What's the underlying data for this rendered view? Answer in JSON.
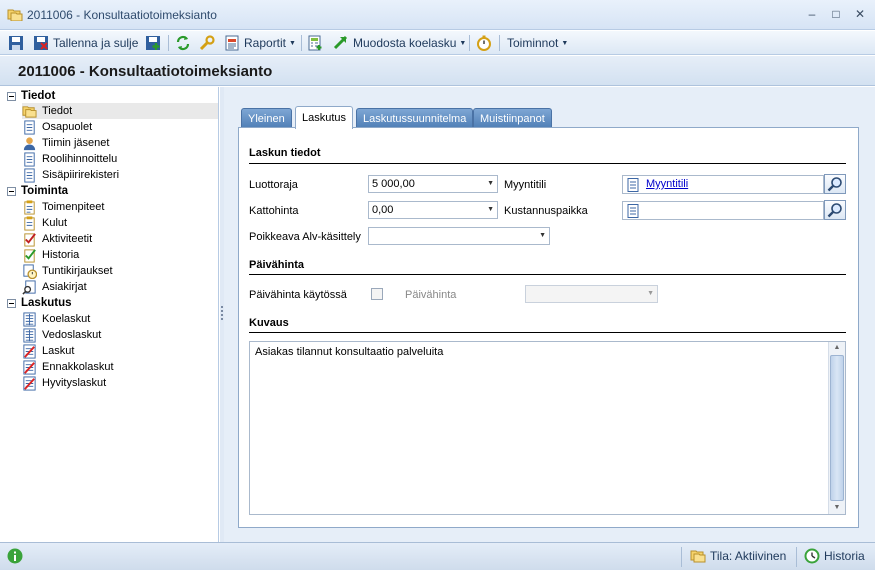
{
  "window": {
    "title": "2011006 - Konsultaatiotoimeksianto"
  },
  "toolbar": {
    "save_close_label": "Tallenna ja sulje",
    "reports_label": "Raportit",
    "invoice_label": "Muodosta koelasku",
    "actions_label": "Toiminnot"
  },
  "header": {
    "title": "2011006 - Konsultaatiotoimeksianto"
  },
  "sidebar": {
    "groups": [
      {
        "label": "Tiedot",
        "items": [
          "Tiedot",
          "Osapuolet",
          "Tiimin jäsenet",
          "Roolihinnoittelu",
          "Sisäpiirirekisteri"
        ]
      },
      {
        "label": "Toiminta",
        "items": [
          "Toimenpiteet",
          "Kulut",
          "Aktiviteetit",
          "Historia",
          "Tuntikirjaukset",
          "Asiakirjat"
        ]
      },
      {
        "label": "Laskutus",
        "items": [
          "Koelaskut",
          "Vedoslaskut",
          "Laskut",
          "Ennakkolaskut",
          "Hyvityslaskut"
        ]
      }
    ]
  },
  "tabs": [
    "Yleinen",
    "Laskutus",
    "Laskutussuunnitelma",
    "Muistiinpanot"
  ],
  "active_tab": "Laskutus",
  "form": {
    "section_invoice": "Laskun tiedot",
    "credit_limit_label": "Luottoraja",
    "credit_limit_value": "5 000,00",
    "ceiling_price_label": "Kattohinta",
    "ceiling_price_value": "0,00",
    "vat_label": "Poikkeava Alv-käsittely",
    "vat_value": "",
    "sales_account_label": "Myyntitili",
    "sales_account_value": "Myyntitili",
    "cost_center_label": "Kustannuspaikka",
    "cost_center_value": "",
    "section_daily": "Päivähinta",
    "daily_in_use_label": "Päivähinta käytössä",
    "daily_in_use_checked": false,
    "daily_price_label": "Päivähinta",
    "daily_price_value": "",
    "section_description": "Kuvaus",
    "description_text": "Asiakas tilannut konsultaatio palveluita"
  },
  "status": {
    "state_label": "Tila: Aktiivinen",
    "history_label": "Historia"
  },
  "icons": {
    "save": "save-icon",
    "save_close": "save-close-icon",
    "save_new": "save-new-icon",
    "refresh": "refresh-icon",
    "tools": "wrench-icon",
    "report": "report-icon",
    "invoice": "invoice-icon",
    "stopwatch": "stopwatch-icon",
    "search": "search-icon",
    "info": "info-icon",
    "history": "history-icon"
  }
}
